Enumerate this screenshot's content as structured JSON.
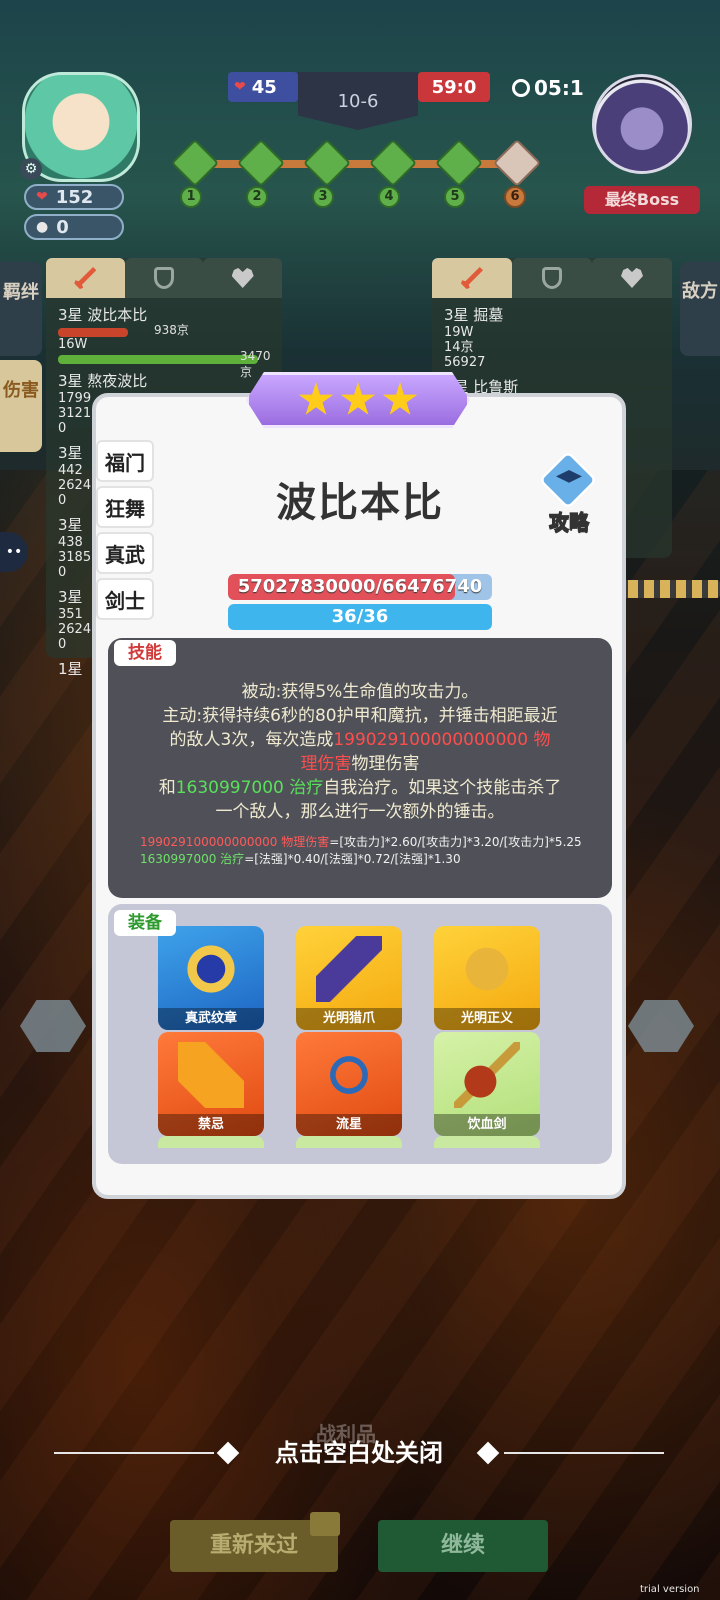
{
  "hud": {
    "player_hp": "152",
    "player_coins": "0",
    "lives": "45",
    "stage": "10-6",
    "score": "59:0",
    "timer": "05:1",
    "boss_label": "最终Boss",
    "waves": [
      "1",
      "2",
      "3",
      "4",
      "5",
      "6"
    ]
  },
  "side_tabs": {
    "left": [
      "羁绊",
      "伤害"
    ],
    "right": "敌方"
  },
  "left_panel": {
    "units": [
      {
        "name": "3星 波比本比",
        "red_value": "938京",
        "green_value": "3470京",
        "hp": "16W"
      },
      {
        "name": "3星 熬夜波比",
        "lines": [
          "1799",
          "3121",
          "0"
        ]
      },
      {
        "name": "3星",
        "lines": [
          "442",
          "2624",
          "0"
        ]
      },
      {
        "name": "3星",
        "lines": [
          "438",
          "3185",
          "0"
        ]
      },
      {
        "name": "3星",
        "lines": [
          "351",
          "2624",
          "0"
        ]
      },
      {
        "name": "1星"
      }
    ]
  },
  "right_panel": {
    "units": [
      {
        "name": "3星 掘墓",
        "lines": [
          "19W",
          "14京",
          "56927"
        ]
      },
      {
        "name": "3星 比鲁斯"
      }
    ]
  },
  "popup": {
    "stars": 3,
    "categories": [
      "福门",
      "狂舞",
      "真武",
      "剑士"
    ],
    "hero_name": "波比本比",
    "guide_label": "攻略",
    "hp_text": "57027830000/66476740",
    "hp_fraction": 0.86,
    "mp_text": "36/36",
    "skill_tag": "技能",
    "skill": {
      "line1": "被动:获得5%生命值的攻击力。",
      "line2": "主动:获得持续6秒的80护甲和魔抗，并锤击相距最近",
      "line3_pre": "的敌人3次，每次造成",
      "damage_num": "199029100000000000",
      "damage_word": " 物",
      "line4_red": "理伤害",
      "line4_rest": "物理伤害",
      "line5_pre": "和",
      "heal_num": "1630997000",
      "heal_word": " 治疗",
      "line5_rest": "自我治疗。如果这个技能击杀了",
      "line6": "一个敌人，那么进行一次额外的锤击。"
    },
    "formula": {
      "dmg_num": "199029100000000000",
      "dmg_label": " 物理伤害",
      "dmg_expr": "=[攻击力]*2.60/[攻击力]*3.20/[攻击力]*5.25",
      "heal_num": "1630997000",
      "heal_label": " 治疗",
      "heal_expr": "=[法强]*0.40/[法强]*0.72/[法强]*1.30"
    },
    "equip_tag": "装备",
    "equipment": [
      {
        "name": "真武纹章",
        "icon": "emblem-icon"
      },
      {
        "name": "光明猎爪",
        "icon": "claw-icon"
      },
      {
        "name": "光明正义",
        "icon": "gauntlet-icon"
      },
      {
        "name": "禁忌",
        "icon": "crystal-icon"
      },
      {
        "name": "流星",
        "icon": "bow-icon"
      },
      {
        "name": "饮血剑",
        "icon": "scythe-icon"
      }
    ]
  },
  "bottom": {
    "loot_label": "战利品",
    "close_hint": "点击空白处关闭",
    "retry_button": "重新来过",
    "continue_button": "继续",
    "watermark": "trial version"
  }
}
